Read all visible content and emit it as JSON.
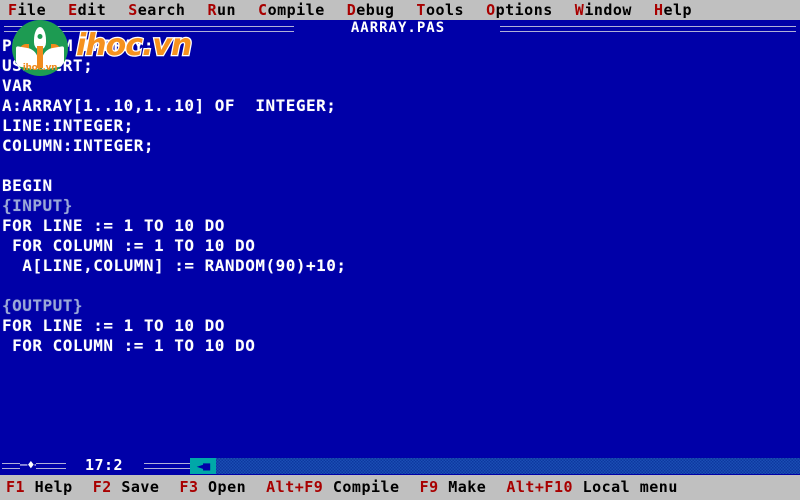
{
  "menubar": {
    "items": [
      {
        "name": "file",
        "hot": "F",
        "rest": "ile"
      },
      {
        "name": "edit",
        "hot": "E",
        "rest": "dit"
      },
      {
        "name": "search",
        "hot": "S",
        "rest": "earch"
      },
      {
        "name": "run",
        "hot": "R",
        "rest": "un"
      },
      {
        "name": "compile",
        "hot": "C",
        "rest": "ompile"
      },
      {
        "name": "debug",
        "hot": "D",
        "rest": "ebug"
      },
      {
        "name": "tools",
        "hot": "T",
        "rest": "ools"
      },
      {
        "name": "options",
        "hot": "O",
        "rest": "ptions"
      },
      {
        "name": "window",
        "hot": "W",
        "rest": "indow"
      },
      {
        "name": "help",
        "hot": "H",
        "rest": "elp"
      }
    ]
  },
  "editor": {
    "title": "AARRAY.PAS",
    "cursor_position": "17:2",
    "resize_glyph": "─♦─",
    "scroll_thumb_glyph": "◄■",
    "lines": [
      {
        "text": "PROGRAM AARRAY;",
        "kind": "code"
      },
      {
        "text": "USES CRT;",
        "kind": "code"
      },
      {
        "text": "VAR",
        "kind": "code"
      },
      {
        "text": "A:ARRAY[1..10,1..10] OF  INTEGER;",
        "kind": "code"
      },
      {
        "text": "LINE:INTEGER;",
        "kind": "code"
      },
      {
        "text": "COLUMN:INTEGER;",
        "kind": "code"
      },
      {
        "text": "",
        "kind": "blank"
      },
      {
        "text": "BEGIN",
        "kind": "code"
      },
      {
        "text": "{INPUT}",
        "kind": "comment"
      },
      {
        "text": "FOR LINE := 1 TO 10 DO",
        "kind": "code"
      },
      {
        "text": " FOR COLUMN := 1 TO 10 DO",
        "kind": "code"
      },
      {
        "text": "  A[LINE,COLUMN] := RANDOM(90)+10;",
        "kind": "code"
      },
      {
        "text": "",
        "kind": "blank"
      },
      {
        "text": "{OUTPUT}",
        "kind": "comment"
      },
      {
        "text": "FOR LINE := 1 TO 10 DO",
        "kind": "code"
      },
      {
        "text": " FOR COLUMN := 1 TO 10 DO",
        "kind": "code"
      }
    ]
  },
  "statusbar": {
    "items": [
      {
        "name": "help",
        "key": "F1",
        "label": "Help"
      },
      {
        "name": "save",
        "key": "F2",
        "label": "Save"
      },
      {
        "name": "open",
        "key": "F3",
        "label": "Open"
      },
      {
        "name": "compile",
        "key": "Alt+F9",
        "label": "Compile"
      },
      {
        "name": "make",
        "key": "F9",
        "label": "Make"
      },
      {
        "name": "local-menu",
        "key": "Alt+F10",
        "label": "Local menu"
      }
    ]
  },
  "watermark": {
    "wordmark": "ihoc.vn",
    "badge_text": "ihoc.vn"
  },
  "colors": {
    "menubar_background": "#c0c0c0",
    "menubar_text": "#000000",
    "hotkey_red": "#a80000",
    "editor_background": "#0000a8",
    "editor_text": "#ffffff",
    "comment_text": "#9aa8d8",
    "scrollbar_thumb": "#00a8a8",
    "logo_green": "#1d9b52",
    "logo_orange": "#f6921e"
  }
}
